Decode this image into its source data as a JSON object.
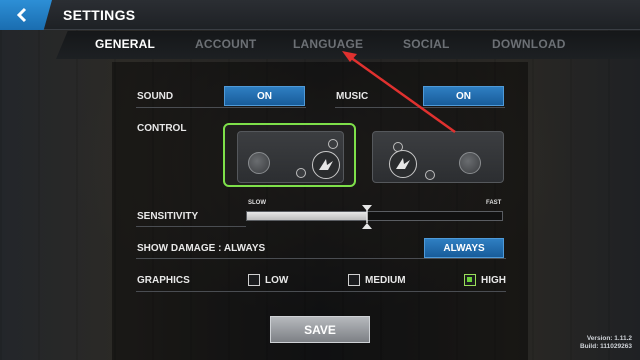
{
  "header": {
    "title": "SETTINGS",
    "back_icon": "chevron-left-icon",
    "accent": "#2d8fd6"
  },
  "tabs": [
    {
      "label": "GENERAL",
      "active": true
    },
    {
      "label": "ACCOUNT",
      "active": false
    },
    {
      "label": "LANGUAGE",
      "active": false
    },
    {
      "label": "SOCIAL",
      "active": false
    },
    {
      "label": "DOWNLOAD",
      "active": false
    }
  ],
  "sound": {
    "label": "SOUND",
    "value": "ON"
  },
  "music": {
    "label": "MUSIC",
    "value": "ON"
  },
  "control": {
    "label": "CONTROL",
    "selected": "left-stick-layout",
    "selected_color": "#7ee04a"
  },
  "sensitivity": {
    "label": "SENSITIVITY",
    "min_label": "SLOW",
    "max_label": "FAST",
    "value_fraction": 0.47
  },
  "show_damage": {
    "label": "SHOW DAMAGE : ALWAYS",
    "value": "ALWAYS"
  },
  "graphics": {
    "label": "GRAPHICS",
    "options": [
      {
        "label": "LOW",
        "checked": false
      },
      {
        "label": "MEDIUM",
        "checked": false
      },
      {
        "label": "HIGH",
        "checked": true
      }
    ]
  },
  "save_label": "SAVE",
  "version": {
    "line1": "Version: 1.11.2",
    "line2": "Build: 111029263"
  },
  "annotation": {
    "type": "red-arrow",
    "color": "#e0312f",
    "points_to": "LANGUAGE"
  }
}
